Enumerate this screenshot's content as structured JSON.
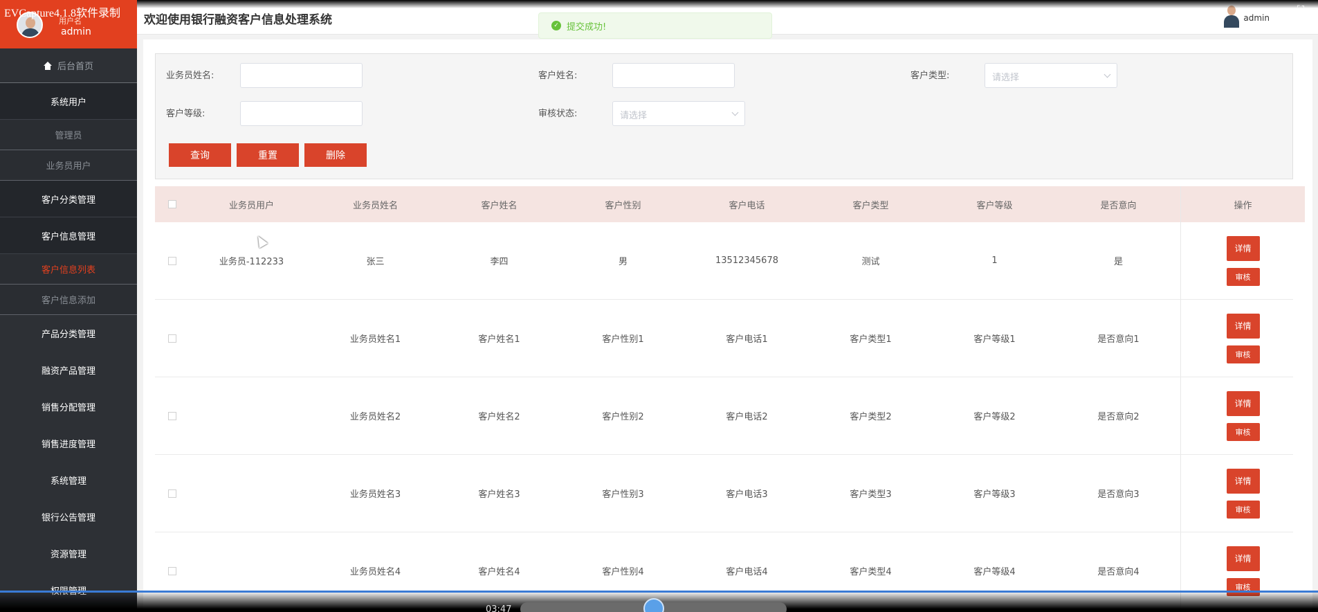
{
  "recorder": {
    "title": "EVCapture4.1.8软件录制",
    "time": "03:47"
  },
  "sidebar": {
    "user_label": "用户名",
    "user_name": "admin",
    "home": "后台首页",
    "items": [
      {
        "label": "系统用户",
        "type": "group"
      },
      {
        "label": "管理员",
        "type": "sub"
      },
      {
        "label": "业务员用户",
        "type": "sub"
      },
      {
        "label": "客户分类管理",
        "type": "group"
      },
      {
        "label": "客户信息管理",
        "type": "group"
      },
      {
        "label": "客户信息列表",
        "type": "sub-active"
      },
      {
        "label": "客户信息添加",
        "type": "sub"
      },
      {
        "label": "产品分类管理",
        "type": "main"
      },
      {
        "label": "融资产品管理",
        "type": "main"
      },
      {
        "label": "销售分配管理",
        "type": "main"
      },
      {
        "label": "销售进度管理",
        "type": "main"
      },
      {
        "label": "系统管理",
        "type": "main"
      },
      {
        "label": "银行公告管理",
        "type": "main"
      },
      {
        "label": "资源管理",
        "type": "main"
      },
      {
        "label": "权限管理",
        "type": "main"
      }
    ]
  },
  "header": {
    "title": "欢迎使用银行融资客户信息处理系统",
    "user": "admin"
  },
  "toast": {
    "text": "提交成功!"
  },
  "search": {
    "salesman_name_label": "业务员姓名:",
    "customer_name_label": "客户姓名:",
    "customer_type_label": "客户类型:",
    "customer_level_label": "客户等级:",
    "audit_status_label": "审核状态:",
    "select_placeholder": "请选择",
    "query_btn": "查询",
    "reset_btn": "重置",
    "delete_btn": "删除"
  },
  "table": {
    "headers": [
      "业务员用户",
      "业务员姓名",
      "客户姓名",
      "客户性别",
      "客户电话",
      "客户类型",
      "客户等级",
      "是否意向",
      "操作"
    ],
    "detail_btn": "详情",
    "audit_btn": "审核",
    "rows": [
      [
        "业务员-112233",
        "张三",
        "李四",
        "男",
        "13512345678",
        "测试",
        "1",
        "是"
      ],
      [
        "",
        "业务员姓名1",
        "客户姓名1",
        "客户性别1",
        "客户电话1",
        "客户类型1",
        "客户等级1",
        "是否意向1"
      ],
      [
        "",
        "业务员姓名2",
        "客户姓名2",
        "客户性别2",
        "客户电话2",
        "客户类型2",
        "客户等级2",
        "是否意向2"
      ],
      [
        "",
        "业务员姓名3",
        "客户姓名3",
        "客户性别3",
        "客户电话3",
        "客户类型3",
        "客户等级3",
        "是否意向3"
      ],
      [
        "",
        "业务员姓名4",
        "客户姓名4",
        "客户性别4",
        "客户电话4",
        "客户类型4",
        "客户等级4",
        "是否意向4"
      ]
    ]
  }
}
